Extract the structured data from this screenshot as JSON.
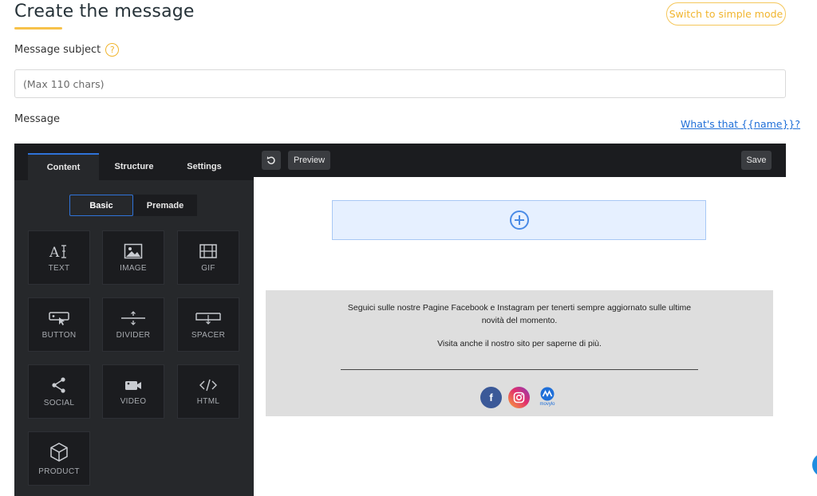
{
  "header": {
    "title": "Create the message",
    "simple_mode_label": "Switch to simple mode"
  },
  "subject": {
    "label": "Message subject",
    "help_glyph": "?",
    "placeholder": "(Max 110 chars)",
    "value": ""
  },
  "message": {
    "label": "Message",
    "name_link": "What's that {{name}}?"
  },
  "editor": {
    "tabs": [
      {
        "label": "Content",
        "active": true
      },
      {
        "label": "Structure",
        "active": false
      },
      {
        "label": "Settings",
        "active": false
      }
    ],
    "segments": [
      {
        "label": "Basic",
        "active": true
      },
      {
        "label": "Premade",
        "active": false
      }
    ],
    "blocks": [
      {
        "label": "TEXT",
        "icon": "text-icon"
      },
      {
        "label": "IMAGE",
        "icon": "image-icon"
      },
      {
        "label": "GIF",
        "icon": "gif-icon"
      },
      {
        "label": "BUTTON",
        "icon": "button-icon"
      },
      {
        "label": "DIVIDER",
        "icon": "divider-icon"
      },
      {
        "label": "SPACER",
        "icon": "spacer-icon"
      },
      {
        "label": "SOCIAL",
        "icon": "share-icon"
      },
      {
        "label": "VIDEO",
        "icon": "video-icon"
      },
      {
        "label": "HTML",
        "icon": "code-icon"
      },
      {
        "label": "PRODUCT",
        "icon": "box-icon"
      }
    ],
    "toolbar": {
      "preview_label": "Preview",
      "save_label": "Save",
      "undo_icon": "undo-icon"
    },
    "canvas": {
      "add_icon": "plus-circle-icon",
      "footer_text_1": "Seguici sulle nostre Pagine Facebook e Instagram per tenerti sempre aggiornato sulle ultime novità del momento.",
      "footer_text_2": "Visita anche il nostro sito per saperne di più.",
      "social": [
        {
          "icon": "facebook-icon",
          "glyph": "f",
          "color": "#3b5998"
        },
        {
          "icon": "instagram-icon",
          "color": "#e1306c"
        },
        {
          "icon": "movylo-icon",
          "caption": "movylo",
          "color": "#1f6fd8"
        }
      ]
    }
  },
  "colors": {
    "accent_yellow": "#f1b52e",
    "link_blue": "#1f6fd8",
    "editor_dark": "#1b1c1f",
    "editor_panel": "#26282b",
    "active_blue": "#2f73d9"
  }
}
